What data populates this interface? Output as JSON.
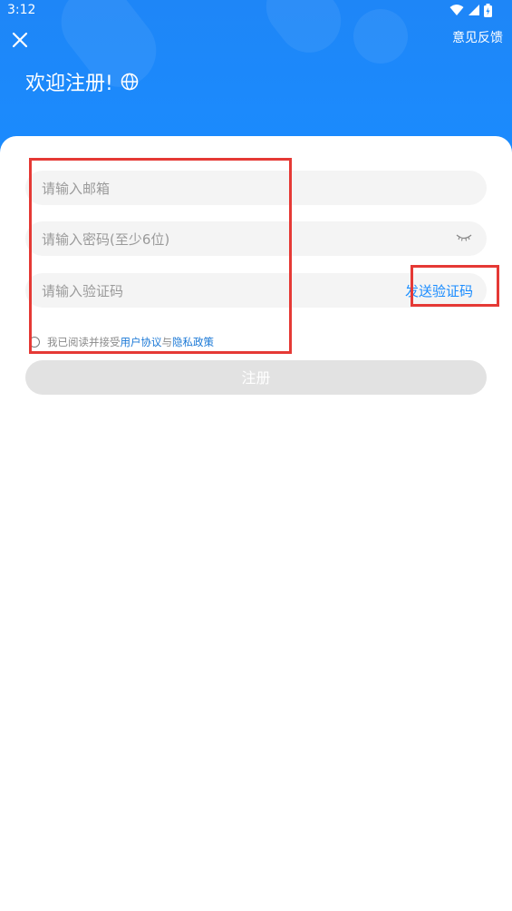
{
  "status_bar": {
    "time": "3:12",
    "icons": [
      "wifi-icon",
      "signal-icon",
      "battery-icon"
    ]
  },
  "header": {
    "close_icon": "close-icon",
    "feedback_label": "意见反馈",
    "title": "欢迎注册!",
    "globe_icon": "globe-icon",
    "background_color": "#1a8cff"
  },
  "form": {
    "email_placeholder": "请输入邮箱",
    "email_value": "",
    "password_placeholder": "请输入密码(至少6位)",
    "password_value": "",
    "password_toggle_icon": "eye-closed-icon",
    "code_placeholder": "请输入验证码",
    "code_value": "",
    "send_code_label": "发送验证码"
  },
  "agreement": {
    "prefix": "我已阅读并接受",
    "user_agreement": "用户协议",
    "conjunction": "与",
    "privacy_policy": "隐私政策",
    "checked": false
  },
  "register_button": {
    "label": "注册",
    "enabled": false
  },
  "colors": {
    "accent": "#1a8cff",
    "link": "#1a78d6",
    "highlight": "#e53935",
    "disabled_button": "#e2e2e2"
  }
}
